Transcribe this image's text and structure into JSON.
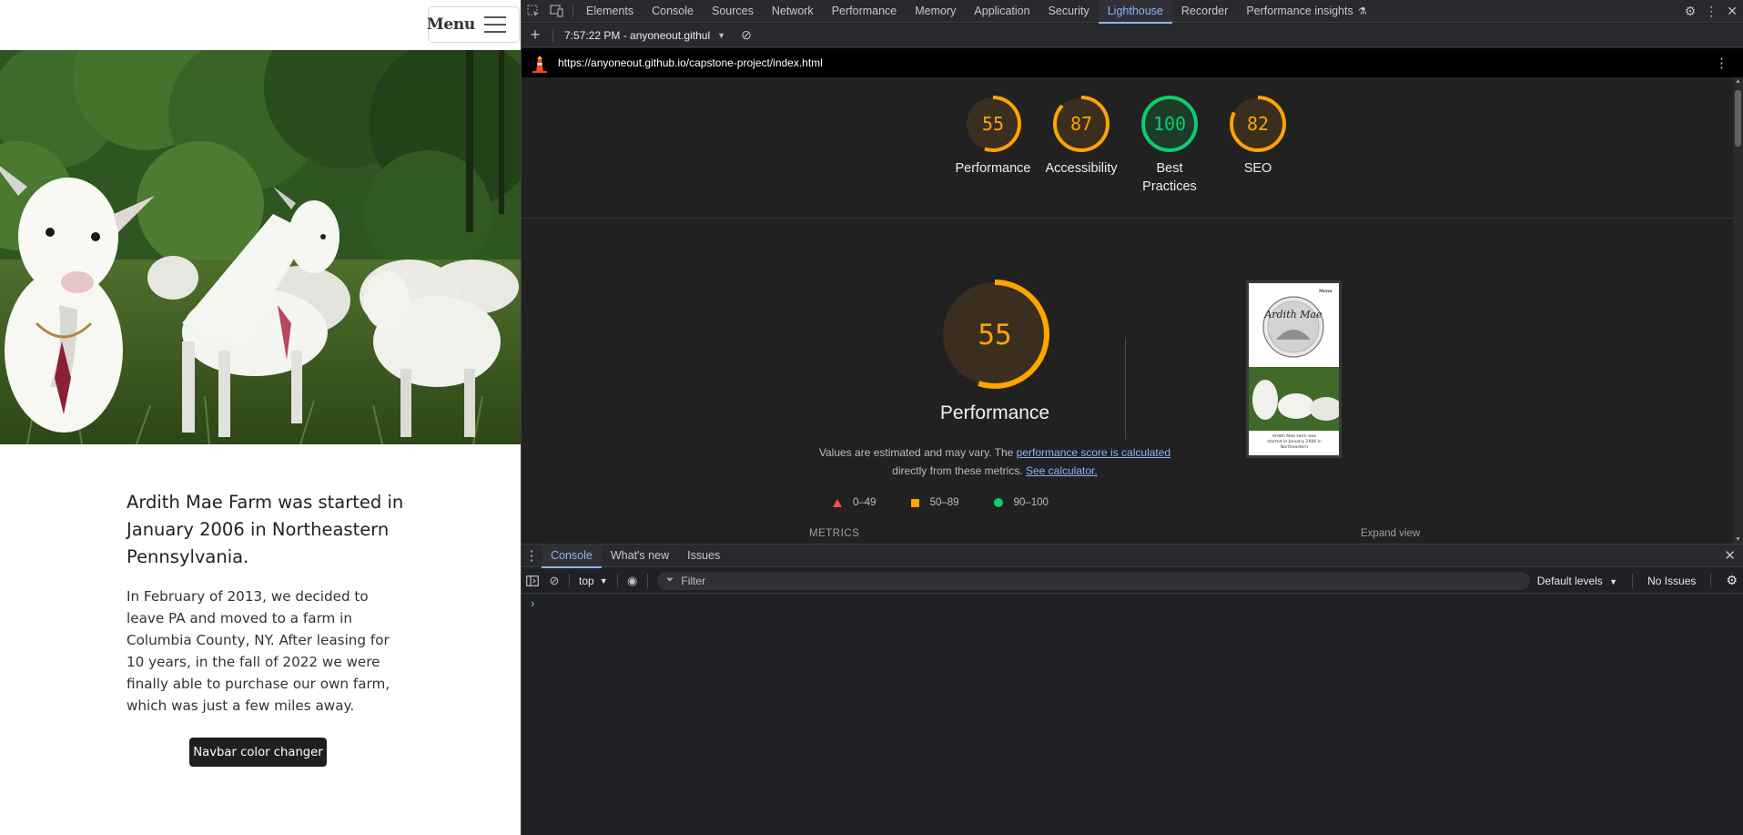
{
  "site": {
    "menu_label": "Menu",
    "intro": "Ardith Mae Farm was started in January 2006 in Northeastern Pennsylvania.",
    "story": "In February of 2013, we decided to leave PA and moved to a farm in Columbia County, NY. After leasing for 10 years, in the fall of 2022 we were finally able to purchase our own farm, which was just a few miles away.",
    "button_label": "Navbar color changer"
  },
  "devtools": {
    "tabs": [
      "Elements",
      "Console",
      "Sources",
      "Network",
      "Performance",
      "Memory",
      "Application",
      "Security",
      "Lighthouse",
      "Recorder",
      "Performance insights"
    ],
    "active_tab": "Lighthouse",
    "report_selector": "7:57:22 PM - anyoneout.githul",
    "url": "https://anyoneout.github.io/capstone-project/index.html",
    "scores": [
      {
        "label": "Performance",
        "value": 55,
        "color": "#ffa400"
      },
      {
        "label": "Accessibility",
        "value": 87,
        "color": "#ffa400"
      },
      {
        "label": "Best Practices",
        "value": 100,
        "color": "#0cce6b"
      },
      {
        "label": "SEO",
        "value": 82,
        "color": "#ffa400"
      }
    ],
    "performance": {
      "title": "Performance",
      "score": 55,
      "note_prefix": "Values are estimated and may vary. The ",
      "note_link1": "performance score is calculated",
      "note_middle": " directly from these metrics. ",
      "note_link2": "See calculator."
    },
    "legend": [
      {
        "label": "0–49",
        "color": "#ff4e42"
      },
      {
        "label": "50–89",
        "color": "#ffa400"
      },
      {
        "label": "90–100",
        "color": "#0cce6b"
      }
    ],
    "metrics_label": "METRICS",
    "expand_label": "Expand view",
    "thumb_text": "Ardith Mae Farm was started in January 2006 in Northeastern",
    "thumb_menu": "Menu",
    "thumb_logo": "Ardith Mae",
    "drawer_tabs": [
      "Console",
      "What's new",
      "Issues"
    ],
    "active_drawer_tab": "Console",
    "context": "top",
    "filter_placeholder": "Filter",
    "default_levels": "Default levels",
    "issues": "No Issues",
    "prompt": "›"
  }
}
